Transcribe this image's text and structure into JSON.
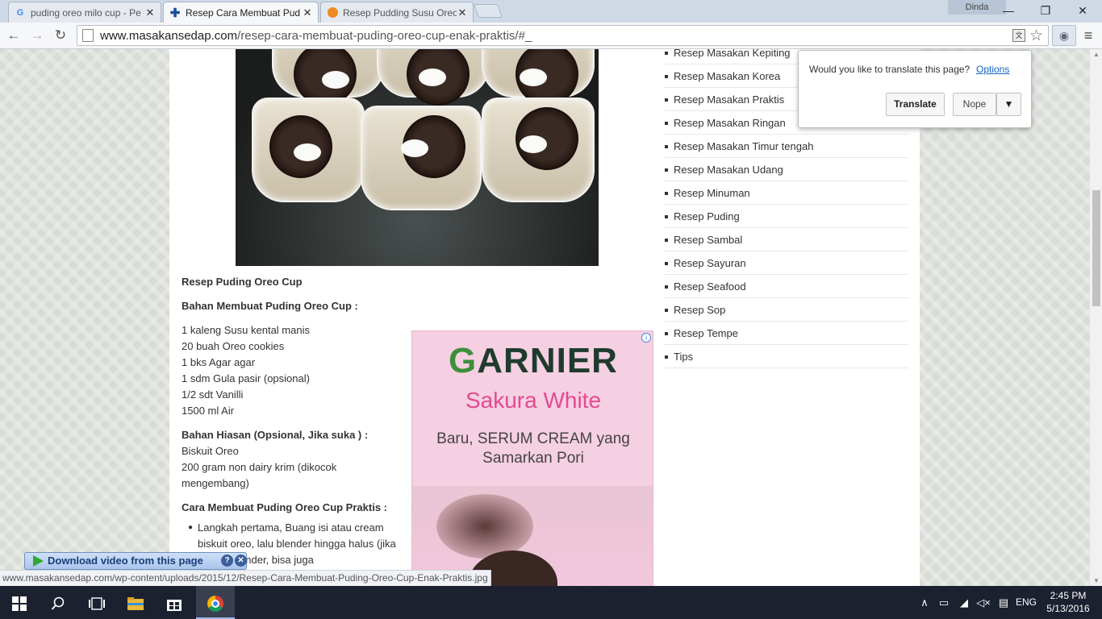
{
  "browser": {
    "tabs": [
      {
        "title": "puding oreo milo cup - Pe",
        "active": false,
        "favicon": "google-icon"
      },
      {
        "title": "Resep Cara Membuat Pud",
        "active": true,
        "favicon": "masakansedap-icon"
      },
      {
        "title": "Resep Pudding Susu Oreo",
        "active": false,
        "favicon": "cookpad-icon"
      }
    ],
    "profile_name": "Dinda",
    "url_host": "www.masakansedap.com",
    "url_path": "/resep-cara-membuat-puding-oreo-cup-enak-praktis/#_",
    "controls": {
      "minimize": "—",
      "restore": "❐",
      "close": "✕"
    }
  },
  "translate_bubble": {
    "question": "Would you like to translate this page?",
    "options_link": "Options",
    "translate_button": "Translate",
    "nope_button": "Nope"
  },
  "article": {
    "title": "Resep Puding Oreo Cup",
    "ingredients_heading": "Bahan Membuat Puding Oreo Cup :",
    "ingredients": [
      "1 kaleng Susu kental manis",
      "20 buah Oreo cookies",
      "1 bks Agar agar",
      "1 sdm Gula pasir (opsional)",
      "1/2 sdt Vanilli",
      "1500 ml Air"
    ],
    "garnish_heading": "Bahan Hiasan (Opsional, Jika suka ) :",
    "garnish": [
      "Biskuit Oreo",
      "200 gram non dairy krim (dikocok mengembang)"
    ],
    "steps_heading": "Cara Membuat Puding Oreo Cup Praktis :",
    "step1": "Langkah pertama, Buang isi atau cream biskuit oreo, lalu blender hingga halus (jika punyai blender, bisa juga"
  },
  "ad": {
    "brand_pre": "G",
    "brand_rest": "ARNIER",
    "product": "Sakura White",
    "copy": "Baru, SERUM CREAM yang Samarkan Pori",
    "info": "i"
  },
  "sidebar": {
    "items": [
      "Resep Masakan Kepiting",
      "Resep Masakan Korea",
      "Resep Masakan Praktis",
      "Resep Masakan Ringan",
      "Resep Masakan Timur tengah",
      "Resep Masakan Udang",
      "Resep Minuman",
      "Resep Puding",
      "Resep Sambal",
      "Resep Sayuran",
      "Resep Seafood",
      "Resep Sop",
      "Resep Tempe",
      "Tips"
    ]
  },
  "download_bar": {
    "label": "Download video from this page",
    "help": "?",
    "close": "✕"
  },
  "status_url": "www.masakansedap.com/wp-content/uploads/2015/12/Resep-Cara-Membuat-Puding-Oreo-Cup-Enak-Praktis.jpg",
  "taskbar": {
    "language": "ENG",
    "time": "2:45 PM",
    "date": "5/13/2016"
  }
}
